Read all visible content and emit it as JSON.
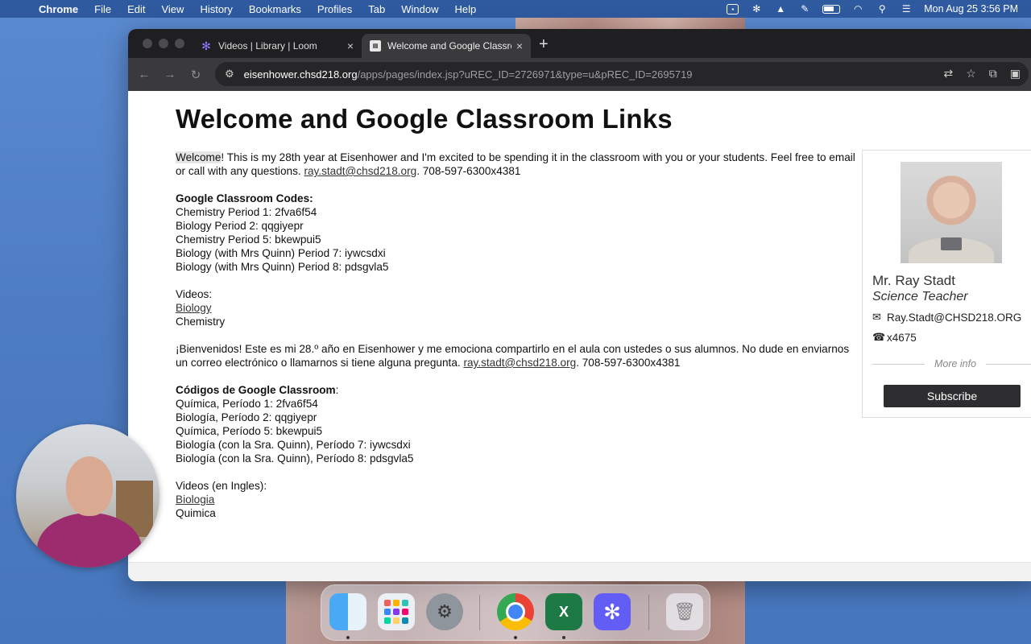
{
  "menubar": {
    "app_name": "Chrome",
    "items": [
      "File",
      "Edit",
      "View",
      "History",
      "Bookmarks",
      "Profiles",
      "Tab",
      "Window",
      "Help"
    ],
    "datetime": "Mon Aug 25  3:56 PM"
  },
  "browser": {
    "tabs": [
      {
        "title": "Videos | Library | Loom",
        "icon": "loom-icon",
        "active": false
      },
      {
        "title": "Welcome and Google Classroom Links",
        "icon": "page-icon",
        "active": true
      }
    ],
    "url_host": "eisenhower.chsd218.org",
    "url_path": "/apps/pages/index.jsp?uREC_ID=2726971&type=u&pREC_ID=2695719"
  },
  "page": {
    "title": "Welcome and Google Classroom Links",
    "intro_welcome": "Welcome",
    "intro_text": "!  This is my 28th year at Eisenhower and I'm excited to be spending it in the classroom with you or your students.  Feel free to email or call with any questions.  ",
    "intro_email": "ray.stadt@chsd218.org",
    "intro_phone": ". 708-597-6300x4381",
    "codes_heading": "Google Classroom Codes:",
    "codes": [
      "Chemistry Period 1:  2fva6f54",
      "Biology Period 2:  qqgiyepr",
      "Chemistry Period 5:  bkewpui5",
      "Biology (with Mrs Quinn) Period 7:  iywcsdxi",
      "Biology (with Mrs Quinn) Period 8:  pdsgvla5"
    ],
    "videos_label": "Videos:",
    "videos_link": "Biology",
    "videos_other": "Chemistry",
    "es_intro_text": "¡Bienvenidos! Este es mi 28.º año en Eisenhower y me emociona compartirlo en el aula con ustedes o sus alumnos.  No dude en enviarnos un correo electrónico o llamarnos si tiene alguna pregunta.  ",
    "es_email": "ray.stadt@chsd218.org",
    "es_phone": ". 708-597-6300x4381",
    "es_codes_heading": "Códigos de Google Classroom",
    "es_codes_colon": ":",
    "es_codes": [
      "Química, Período 1:  2fva6f54",
      "Biología, Período 2:  qqgiyepr",
      "Química, Período 5:  bkewpui5",
      "Biología (con la Sra. Quinn), Período 7: iywcsdxi",
      "Biología (con la Sra. Quinn), Período 8: pdsgvla5"
    ],
    "es_videos_label": "Videos (en Ingles):",
    "es_videos_link": "Biologia",
    "es_videos_other": "Quimica"
  },
  "profile": {
    "name": "Mr. Ray Stadt",
    "role": "Science Teacher",
    "email": "Ray.Stadt@CHSD218.ORG",
    "phone": "x4675",
    "more_info": "More info",
    "subscribe_label": "Subscribe"
  }
}
